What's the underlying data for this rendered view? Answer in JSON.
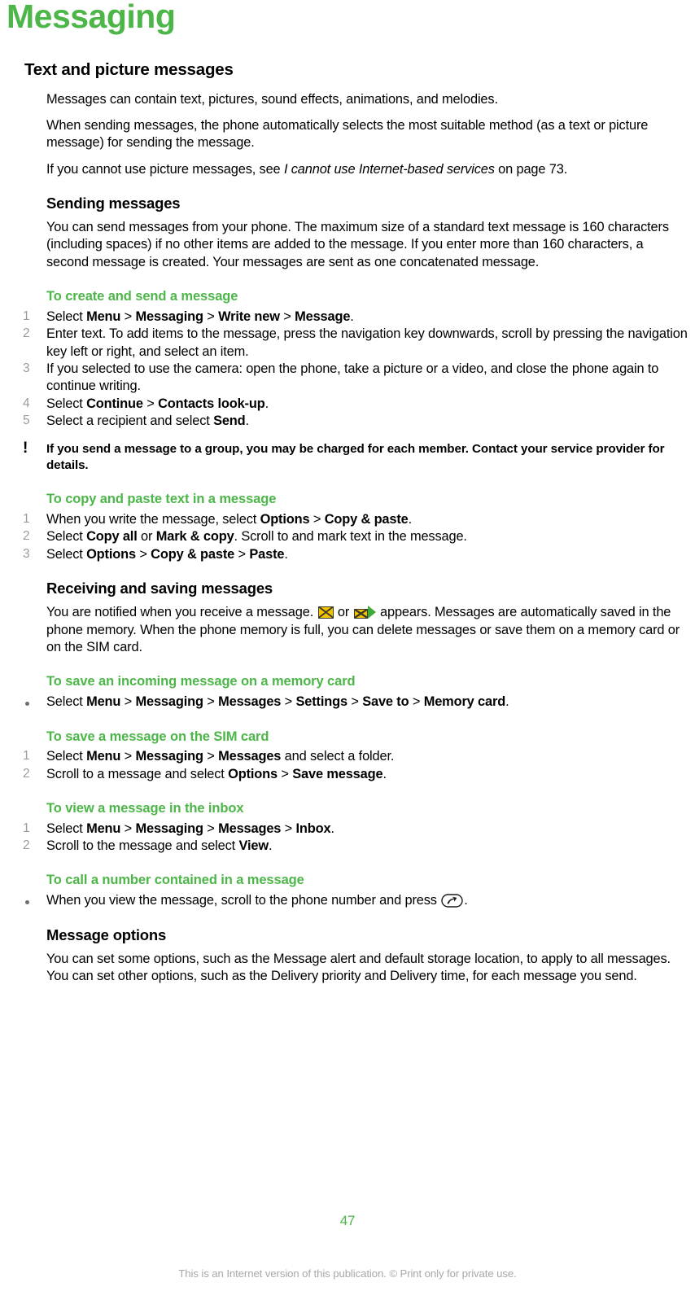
{
  "chapter": {
    "title": "Messaging",
    "accent_color": "#4CB648"
  },
  "sections": {
    "text_and_picture": {
      "heading": "Text and picture messages",
      "p1": "Messages can contain text, pictures, sound effects, animations, and melodies.",
      "p2": "When sending messages, the phone automatically selects the most suitable method (as a text or picture message) for sending the message.",
      "p3_before": "If you cannot use picture messages, see ",
      "p3_italic": "I cannot use Internet-based services",
      "p3_after": " on page 73."
    },
    "sending_messages": {
      "heading": "Sending messages",
      "p1": "You can send messages from your phone. The maximum size of a standard text message is 160 characters (including spaces) if no other items are added to the message. If you enter more than 160 characters, a second message is created. Your messages are sent as one concatenated message.",
      "procedure_create": {
        "heading": "To create and send a message",
        "steps": [
          {
            "num": "1",
            "parts": [
              {
                "t": "Select ",
                "s": "n"
              },
              {
                "t": "Menu",
                "s": "b"
              },
              {
                "t": " > ",
                "s": "n"
              },
              {
                "t": "Messaging",
                "s": "b"
              },
              {
                "t": " > ",
                "s": "n"
              },
              {
                "t": "Write new",
                "s": "b"
              },
              {
                "t": " > ",
                "s": "n"
              },
              {
                "t": "Message",
                "s": "b"
              },
              {
                "t": ".",
                "s": "n"
              }
            ]
          },
          {
            "num": "2",
            "parts": [
              {
                "t": "Enter text. To add items to the message, press the navigation key downwards, scroll by pressing the navigation key left or right, and select an item.",
                "s": "n"
              }
            ]
          },
          {
            "num": "3",
            "parts": [
              {
                "t": "If you selected to use the camera: open the phone, take a picture or a video, and close the phone again to continue writing.",
                "s": "n"
              }
            ]
          },
          {
            "num": "4",
            "parts": [
              {
                "t": "Select ",
                "s": "n"
              },
              {
                "t": "Continue",
                "s": "b"
              },
              {
                "t": " > ",
                "s": "n"
              },
              {
                "t": "Contacts look-up",
                "s": "b"
              },
              {
                "t": ".",
                "s": "n"
              }
            ]
          },
          {
            "num": "5",
            "parts": [
              {
                "t": "Select a recipient and select ",
                "s": "n"
              },
              {
                "t": "Send",
                "s": "b"
              },
              {
                "t": ".",
                "s": "n"
              }
            ]
          }
        ]
      },
      "note": {
        "icon": "exclamation-icon",
        "icon_glyph": "!",
        "text": "If you send a message to a group, you may be charged for each member. Contact your service provider for details."
      },
      "procedure_copy_paste": {
        "heading": "To copy and paste text in a message",
        "steps": [
          {
            "num": "1",
            "parts": [
              {
                "t": "When you write the message, select ",
                "s": "n"
              },
              {
                "t": "Options",
                "s": "b"
              },
              {
                "t": " > ",
                "s": "n"
              },
              {
                "t": "Copy & paste",
                "s": "b"
              },
              {
                "t": ".",
                "s": "n"
              }
            ]
          },
          {
            "num": "2",
            "parts": [
              {
                "t": "Select ",
                "s": "n"
              },
              {
                "t": "Copy all",
                "s": "b"
              },
              {
                "t": " or ",
                "s": "n"
              },
              {
                "t": "Mark & copy",
                "s": "b"
              },
              {
                "t": ". Scroll to and mark text in the message.",
                "s": "n"
              }
            ]
          },
          {
            "num": "3",
            "parts": [
              {
                "t": "Select ",
                "s": "n"
              },
              {
                "t": "Options",
                "s": "b"
              },
              {
                "t": " > ",
                "s": "n"
              },
              {
                "t": "Copy & paste",
                "s": "b"
              },
              {
                "t": " > ",
                "s": "n"
              },
              {
                "t": "Paste",
                "s": "b"
              },
              {
                "t": ".",
                "s": "n"
              }
            ]
          }
        ]
      }
    },
    "receiving_saving": {
      "heading": "Receiving and saving messages",
      "p1_a": "You are notified when you receive a message. ",
      "icon1": "envelope-icon",
      "p1_b": " or ",
      "icon2": "envelope-arrow-icon",
      "p1_c": " appears. Messages are automatically saved in the phone memory. When the phone memory is full, you can delete messages or save them on a memory card or on the SIM card.",
      "procedure_memory_card": {
        "heading": "To save an incoming message on a memory card",
        "bullets": [
          {
            "parts": [
              {
                "t": "Select ",
                "s": "n"
              },
              {
                "t": "Menu",
                "s": "b"
              },
              {
                "t": " > ",
                "s": "n"
              },
              {
                "t": "Messaging",
                "s": "b"
              },
              {
                "t": " > ",
                "s": "n"
              },
              {
                "t": "Messages",
                "s": "b"
              },
              {
                "t": " > ",
                "s": "n"
              },
              {
                "t": "Settings",
                "s": "b"
              },
              {
                "t": " > ",
                "s": "n"
              },
              {
                "t": "Save to",
                "s": "b"
              },
              {
                "t": " > ",
                "s": "n"
              },
              {
                "t": "Memory card",
                "s": "b"
              },
              {
                "t": ".",
                "s": "n"
              }
            ]
          }
        ]
      },
      "procedure_sim_card": {
        "heading": "To save a message on the SIM card",
        "steps": [
          {
            "num": "1",
            "parts": [
              {
                "t": "Select ",
                "s": "n"
              },
              {
                "t": "Menu",
                "s": "b"
              },
              {
                "t": " > ",
                "s": "n"
              },
              {
                "t": "Messaging",
                "s": "b"
              },
              {
                "t": " > ",
                "s": "n"
              },
              {
                "t": "Messages",
                "s": "b"
              },
              {
                "t": " and select a folder.",
                "s": "n"
              }
            ]
          },
          {
            "num": "2",
            "parts": [
              {
                "t": "Scroll to a message and select ",
                "s": "n"
              },
              {
                "t": "Options",
                "s": "b"
              },
              {
                "t": " > ",
                "s": "n"
              },
              {
                "t": "Save message",
                "s": "b"
              },
              {
                "t": ".",
                "s": "n"
              }
            ]
          }
        ]
      },
      "procedure_view_inbox": {
        "heading": "To view a message in the inbox",
        "steps": [
          {
            "num": "1",
            "parts": [
              {
                "t": "Select ",
                "s": "n"
              },
              {
                "t": "Menu",
                "s": "b"
              },
              {
                "t": " > ",
                "s": "n"
              },
              {
                "t": "Messaging",
                "s": "b"
              },
              {
                "t": " > ",
                "s": "n"
              },
              {
                "t": "Messages",
                "s": "b"
              },
              {
                "t": " > ",
                "s": "n"
              },
              {
                "t": "Inbox",
                "s": "b"
              },
              {
                "t": ".",
                "s": "n"
              }
            ]
          },
          {
            "num": "2",
            "parts": [
              {
                "t": "Scroll to the message and select ",
                "s": "n"
              },
              {
                "t": "View",
                "s": "b"
              },
              {
                "t": ".",
                "s": "n"
              }
            ]
          }
        ]
      },
      "procedure_call_number": {
        "heading": "To call a number contained in a message",
        "bullet_before": "When you view the message, scroll to the phone number and press ",
        "icon": "call-key-icon",
        "bullet_after": "."
      }
    },
    "message_options": {
      "heading": "Message options",
      "p1": "You can set some options, such as the Message alert and default storage location, to apply to all messages. You can set other options, such as the Delivery priority and Delivery time, for each message you send."
    }
  },
  "footer": {
    "page_number": "47",
    "notice": "This is an Internet version of this publication. © Print only for private use."
  }
}
